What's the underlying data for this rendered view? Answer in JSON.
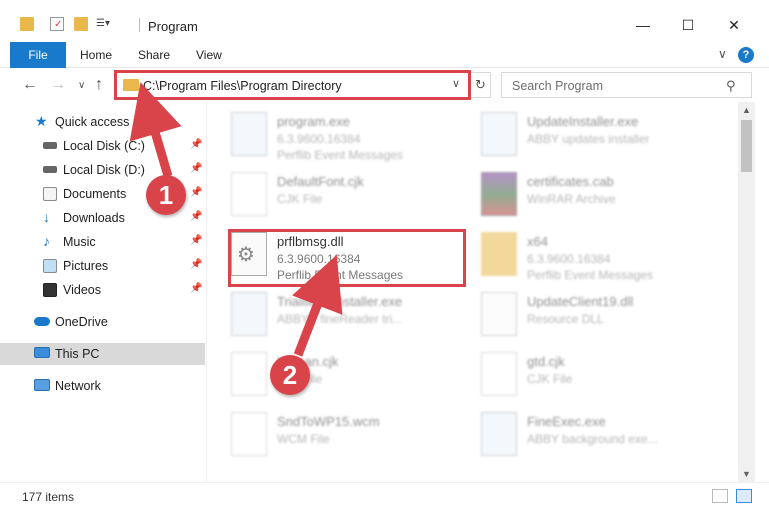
{
  "window": {
    "title": "Program",
    "minimize_glyph": "—",
    "maximize_glyph": "☐",
    "close_glyph": "✕"
  },
  "ribbon": {
    "tabs": [
      {
        "label": "File"
      },
      {
        "label": "Home"
      },
      {
        "label": "Share"
      },
      {
        "label": "View"
      }
    ],
    "expand_glyph": "∨",
    "help_glyph": "?"
  },
  "nav": {
    "back_glyph": "←",
    "forward_glyph": "→",
    "recent_glyph": "∨",
    "up_glyph": "↑"
  },
  "address": {
    "path": "C:\\Program Files\\Program Directory",
    "dropdown_glyph": "∨",
    "refresh_glyph": "↻"
  },
  "search": {
    "placeholder": "Search Program",
    "icon_glyph": "⚲"
  },
  "sidebar": {
    "items": [
      {
        "label": "Quick access",
        "icon": "star-icon"
      },
      {
        "label": "Local Disk (C:)",
        "icon": "drive-icon",
        "pinned": true
      },
      {
        "label": "Local Disk (D:)",
        "icon": "drive-icon",
        "pinned": true
      },
      {
        "label": "Documents",
        "icon": "documents-icon",
        "pinned": true
      },
      {
        "label": "Downloads",
        "icon": "download-icon",
        "pinned": true
      },
      {
        "label": "Music",
        "icon": "music-icon",
        "pinned": true
      },
      {
        "label": "Pictures",
        "icon": "pictures-icon",
        "pinned": true
      },
      {
        "label": "Videos",
        "icon": "videos-icon",
        "pinned": true
      },
      {
        "label": "OneDrive",
        "icon": "cloud-icon"
      },
      {
        "label": "This PC",
        "icon": "computer-icon"
      },
      {
        "label": "Network",
        "icon": "network-icon"
      }
    ],
    "pin_glyph": "📌"
  },
  "files": {
    "left": [
      {
        "name": "program.exe",
        "line1": "6.3.9600.16384",
        "line2": "Perflib Event Messages"
      },
      {
        "name": "DefaultFont.cjk",
        "line1": "CJK File",
        "line2": ""
      },
      {
        "name": "prflbmsg.dll",
        "line1": "6.3.9600.16384",
        "line2": "Perflib Event Messages"
      },
      {
        "name": "TrialitemsInstaller.exe",
        "line1": "ABBYY fineReader tri...",
        "line2": ""
      },
      {
        "name": "Korean.cjk",
        "line1": "CJK File",
        "line2": ""
      },
      {
        "name": "SndToWP15.wcm",
        "line1": "WCM File",
        "line2": ""
      }
    ],
    "right": [
      {
        "name": "UpdateInstaller.exe",
        "line1": "ABBY updates installer",
        "line2": ""
      },
      {
        "name": "certificates.cab",
        "line1": "WinRAR Archive",
        "line2": ""
      },
      {
        "name": "x64",
        "line1": "6.3.9600.16384",
        "line2": "Perflib Event Messages"
      },
      {
        "name": "UpdateClient19.dll",
        "line1": "Resource DLL",
        "line2": ""
      },
      {
        "name": "gtd.cjk",
        "line1": "CJK File",
        "line2": ""
      },
      {
        "name": "FineExec.exe",
        "line1": "ABBY background exe...",
        "line2": ""
      }
    ]
  },
  "status": {
    "count_text": "177 items"
  },
  "annotations": {
    "step1": "1",
    "step2": "2",
    "color": "#d9444b"
  },
  "colors": {
    "accent": "#1979ca",
    "selection": "#cce8ff",
    "highlight": "#d9444b"
  }
}
